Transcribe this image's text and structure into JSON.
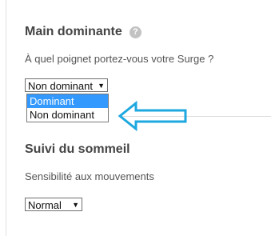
{
  "hand_section": {
    "title": "Main dominante",
    "help_icon": "question-mark-icon",
    "question": "À quel poignet portez-vous votre Surge ?",
    "select": {
      "value": "Non dominant"
    },
    "dropdown_options": [
      {
        "label": "Dominant",
        "highlighted": true
      },
      {
        "label": "Non dominant",
        "highlighted": false
      }
    ]
  },
  "sleep_section": {
    "title": "Suivi du sommeil",
    "question": "Sensibilité aux mouvements",
    "select": {
      "value": "Normal"
    }
  },
  "annotation": {
    "icon": "left-arrow-icon",
    "color": "#1fa8e0"
  },
  "colors": {
    "highlight": "#3399ff"
  }
}
